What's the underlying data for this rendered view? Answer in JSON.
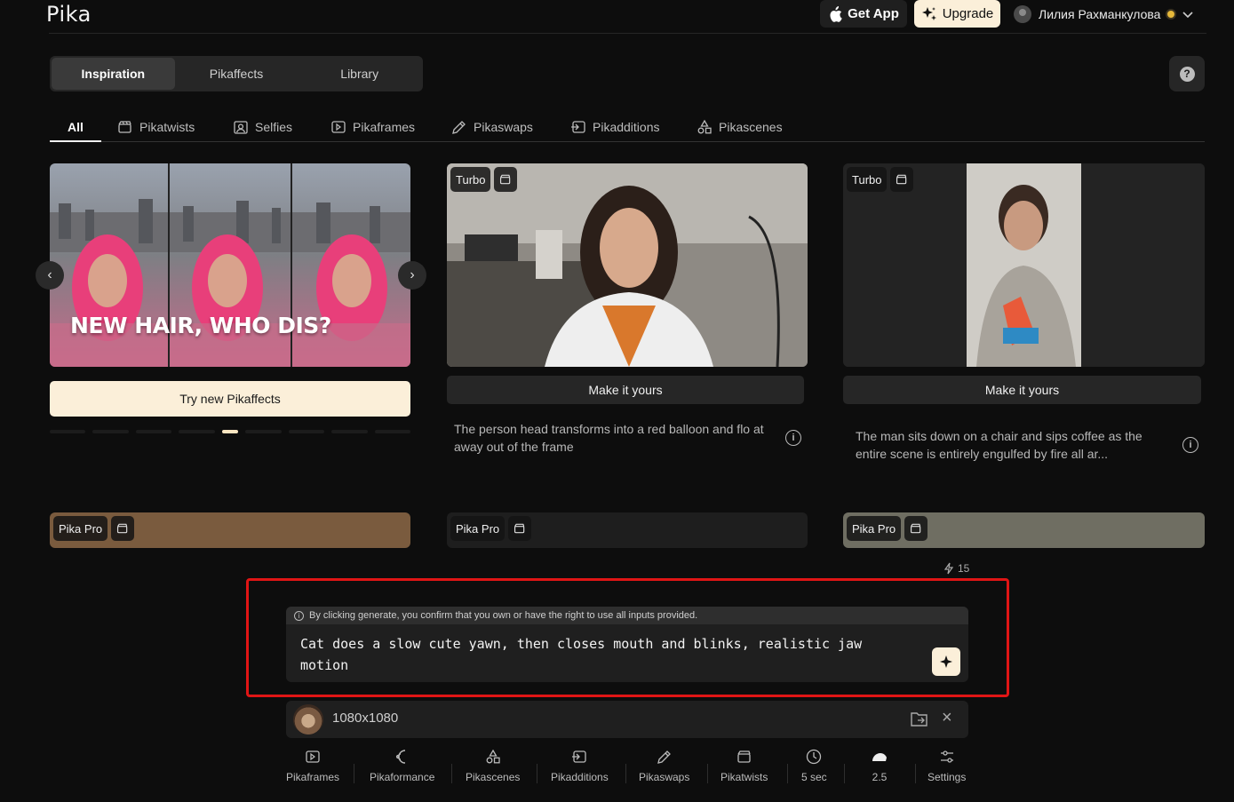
{
  "header": {
    "logo": "Pika",
    "get_app": "Get App",
    "upgrade": "Upgrade",
    "user_name": "Лилия Рахманкулова"
  },
  "top_tabs": [
    "Inspiration",
    "Pikaffects",
    "Library"
  ],
  "active_top_tab": "Inspiration",
  "help": "?",
  "categories": [
    {
      "label": "All",
      "icon": "none"
    },
    {
      "label": "Pikatwists",
      "icon": "twist-icon"
    },
    {
      "label": "Selfies",
      "icon": "selfie-icon"
    },
    {
      "label": "Pikaframes",
      "icon": "frames-icon"
    },
    {
      "label": "Pikaswaps",
      "icon": "swap-icon"
    },
    {
      "label": "Pikadditions",
      "icon": "additions-icon"
    },
    {
      "label": "Pikascenes",
      "icon": "scenes-icon"
    }
  ],
  "promo": {
    "overlay_text": "NEW HAIR, WHO DIS?",
    "button": "Try new Pikaffects",
    "slide_count": 9,
    "active_slide": 5
  },
  "cards": [
    {
      "badge": "Turbo",
      "button": "Make it yours",
      "description": "The person head transforms into a red balloon and flo at away out of the frame"
    },
    {
      "badge": "Turbo",
      "button": "Make it yours",
      "description": "The man sits down on a chair and sips coffee as the entire scene is entirely engulfed by fire all ar..."
    }
  ],
  "row2_badges": [
    "Pika Pro",
    "Pika Pro",
    "Pika Pro"
  ],
  "credits": "15",
  "prompt": {
    "notice": "By clicking generate, you confirm that you own or have the right to use all inputs provided.",
    "text": "Cat does a slow cute yawn, then closes mouth and blinks, realistic jaw motion"
  },
  "asset": {
    "label": "1080x1080"
  },
  "tools": [
    {
      "label": "Pikaframes",
      "icon": "frames-icon"
    },
    {
      "label": "Pikaformance",
      "icon": "performance-icon"
    },
    {
      "label": "Pikascenes",
      "icon": "scenes-icon"
    },
    {
      "label": "Pikadditions",
      "icon": "additions-icon"
    },
    {
      "label": "Pikaswaps",
      "icon": "swap-icon"
    },
    {
      "label": "Pikatwists",
      "icon": "twist-icon"
    },
    {
      "label": "5 sec",
      "icon": "clock-icon"
    },
    {
      "label": "2.5",
      "icon": "model-icon"
    },
    {
      "label": "Settings",
      "icon": "settings-icon"
    }
  ],
  "colors": {
    "accent_cream": "#fbefd9",
    "highlight_red": "#e01515",
    "background": "#0d0d0d"
  }
}
